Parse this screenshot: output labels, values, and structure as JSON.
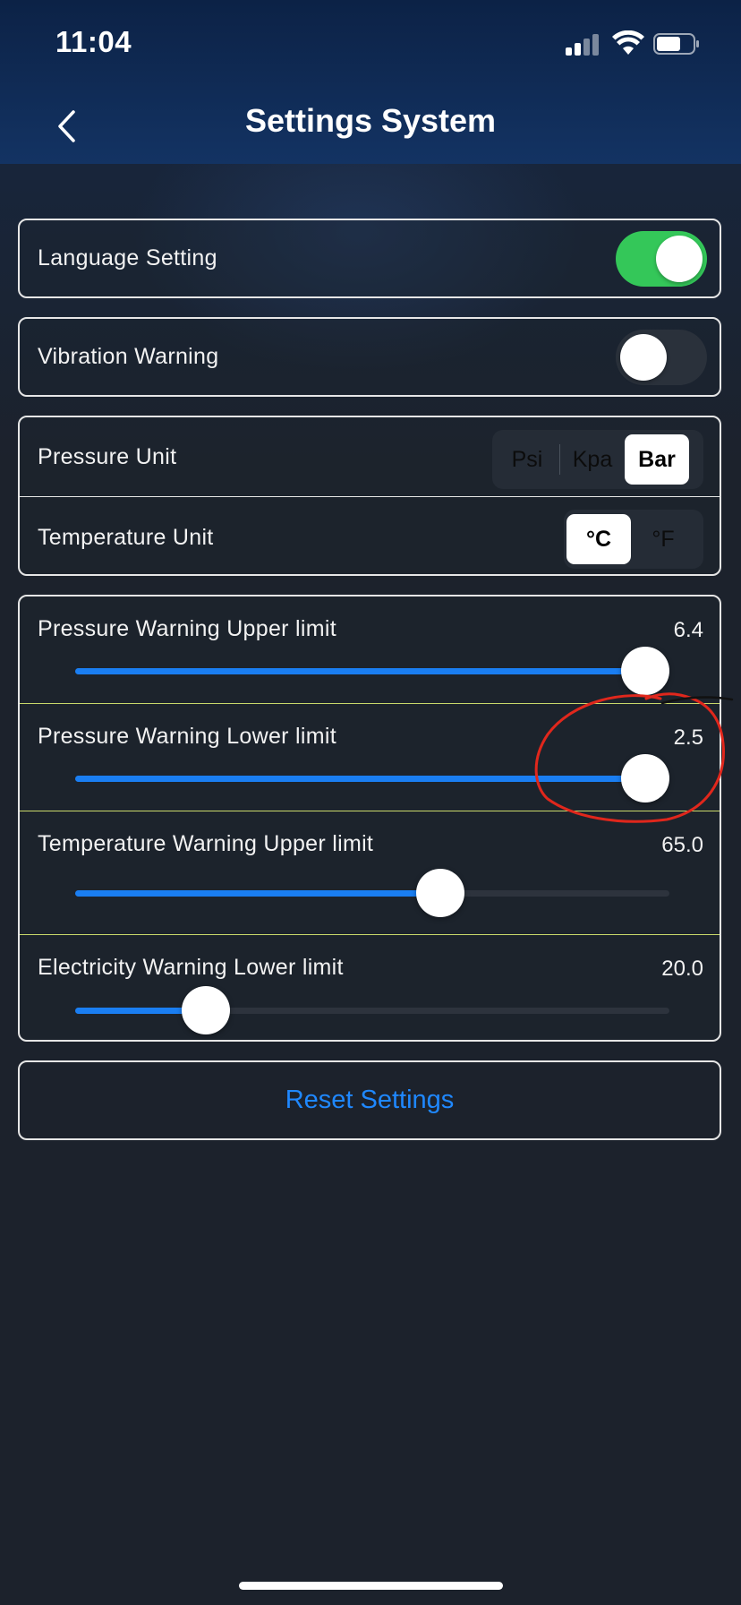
{
  "status_bar": {
    "time": "11:04"
  },
  "nav": {
    "title": "Settings System"
  },
  "settings": {
    "language": {
      "label": "Language Setting",
      "on": true
    },
    "vibration": {
      "label": "Vibration Warning",
      "on": false
    },
    "pressure_unit": {
      "label": "Pressure Unit",
      "options": [
        "Psi",
        "Kpa",
        "Bar"
      ],
      "selected": "Bar"
    },
    "temperature_unit": {
      "label": "Temperature Unit",
      "options": [
        "°C",
        "°F"
      ],
      "selected": "°C"
    }
  },
  "sliders": [
    {
      "label": "Pressure Warning Upper limit",
      "value": "6.4",
      "fraction": 0.96
    },
    {
      "label": "Pressure Warning Lower limit",
      "value": "2.5",
      "fraction": 0.96
    },
    {
      "label": "Temperature Warning Upper limit",
      "value": "65.0",
      "fraction": 0.615
    },
    {
      "label": "Electricity Warning Lower limit",
      "value": "20.0",
      "fraction": 0.22
    }
  ],
  "reset": {
    "label": "Reset Settings"
  },
  "colors": {
    "accent": "#1a7ef2",
    "toggle_on": "#34c759",
    "toggle_off": "#2a313b",
    "divider": "#c9d96a",
    "annotation": "#e0271c"
  },
  "icons": {
    "back": "chevron-left-icon",
    "signal": "cellular-signal-icon",
    "wifi": "wifi-icon",
    "battery": "battery-icon"
  }
}
